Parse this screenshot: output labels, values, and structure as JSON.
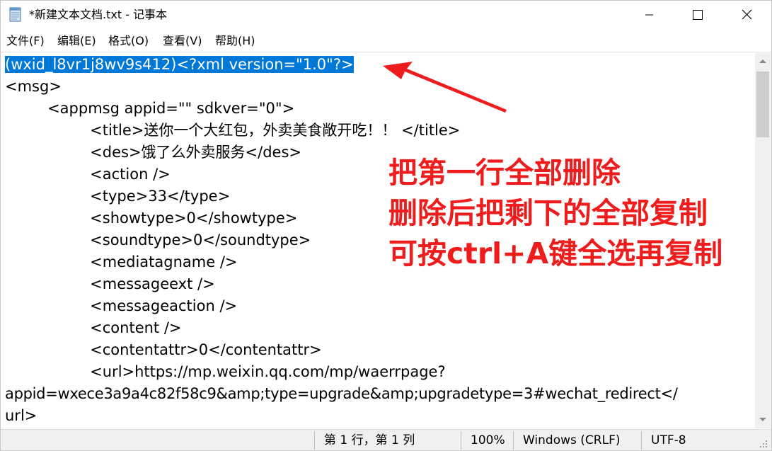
{
  "window": {
    "title": "*新建文本文档.txt - 记事本"
  },
  "menu": [
    {
      "label": "文件(F)"
    },
    {
      "label": "编辑(E)"
    },
    {
      "label": "格式(O)"
    },
    {
      "label": "查看(V)"
    },
    {
      "label": "帮助(H)"
    }
  ],
  "editor": {
    "selected_text": "(wxid_l8vr1j8wv9s412)<?xml version=\"1.0\"?>",
    "lines": [
      "<msg>",
      "\t<appmsg appid=\"\" sdkver=\"0\">",
      "\t\t<title>送你一个大红包，外卖美食敞开吃！！ </title>",
      "\t\t<des>饿了么外卖服务</des>",
      "\t\t<action />",
      "\t\t<type>33</type>",
      "\t\t<showtype>0</showtype>",
      "\t\t<soundtype>0</soundtype>",
      "\t\t<mediatagname />",
      "\t\t<messageext />",
      "\t\t<messageaction />",
      "\t\t<content />",
      "\t\t<contentattr>0</contentattr>",
      "\t\t<url>https://mp.weixin.qq.com/mp/waerrpage?",
      "appid=wxece3a9a4c82f58c9&amp;type=upgrade&amp;upgradetype=3#wechat_redirect</",
      "url>"
    ]
  },
  "annotation": {
    "color": "#ee1c1c",
    "lines": [
      "把第一行全部删除",
      "删除后把剩下的全部复制",
      "可按ctrl+A键全选再复制"
    ]
  },
  "status": {
    "position": "第 1 行，第 1 列",
    "zoom": "100%",
    "line_ending": "Windows (CRLF)",
    "encoding": "UTF-8"
  },
  "colors": {
    "selection": "#0078d7",
    "statusbar_bg": "#f0f0f0"
  }
}
